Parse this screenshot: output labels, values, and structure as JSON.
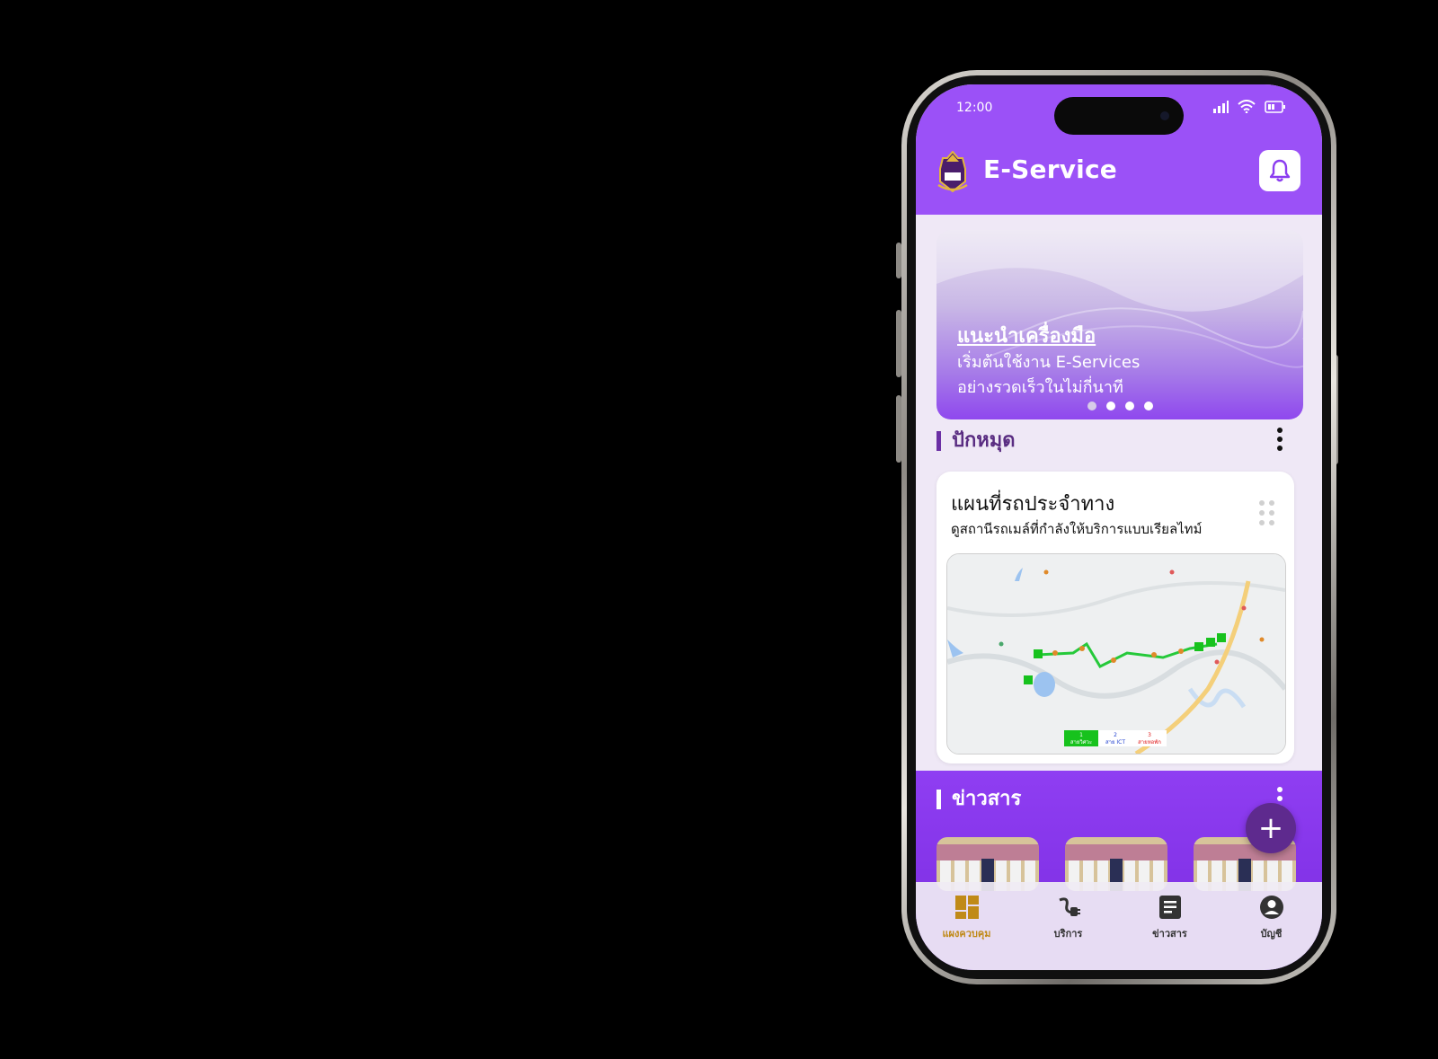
{
  "status_bar": {
    "time": "12:00"
  },
  "header": {
    "title": "E-Service"
  },
  "banner": {
    "title": "แนะนำเครื่องมือ",
    "subtitle_line1": "เริ่มต้นใช้งาน E-Services",
    "subtitle_line2": "อย่างรวดเร็วในไม่กี่นาที",
    "dots": 4,
    "active_dot": 0
  },
  "pinned": {
    "section_title": "ปักหมุด",
    "card": {
      "title": "แผนที่รถประจำทาง",
      "subtitle": "ดูสถานีรถเมล์ที่กำลังให้บริการแบบเรียลไทม์",
      "legend": [
        {
          "num": "1",
          "label": "สายวิศวะ",
          "color": "#17c21d"
        },
        {
          "num": "2",
          "label": "สาย ICT",
          "color": "#1f3fcf"
        },
        {
          "num": "3",
          "label": "สายหอพัก",
          "color": "#e01a1a"
        }
      ]
    }
  },
  "news": {
    "section_title": "ข่าวสาร"
  },
  "fab": {
    "label": "+"
  },
  "nav": {
    "items": [
      {
        "label": "แผงควบคุม",
        "icon": "dashboard-icon",
        "active": true
      },
      {
        "label": "บริการ",
        "icon": "plug-icon",
        "active": false
      },
      {
        "label": "ข่าวสาร",
        "icon": "news-icon",
        "active": false
      },
      {
        "label": "บัญชี",
        "icon": "account-icon",
        "active": false
      }
    ]
  },
  "colors": {
    "primary": "#9b51f7",
    "dark_purple": "#5e2a8e",
    "active_nav": "#c08a18"
  }
}
